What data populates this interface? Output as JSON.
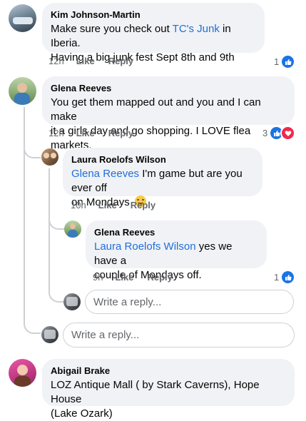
{
  "comments": [
    {
      "author": "Kim Johnson-Martin",
      "text_line1_pre": "Make sure you check out ",
      "text_line1_link": "TC's Junk",
      "text_line1_post": " in Iberia.",
      "text_line2": "Having a big junk fest Sept 8th and 9th",
      "time": "12h",
      "like": "Like",
      "reply": "Reply",
      "reaction_count": "1",
      "reactions": [
        "like-icon"
      ]
    },
    {
      "author": "Glena Reeves",
      "text_line1": "You get them mapped out and you and I can make",
      "text_line2": "it a girls day and go shopping. I LOVE flea markets.",
      "time": "12h",
      "like": "Like",
      "reply": "Reply",
      "reaction_count": "3",
      "reactions": [
        "like-icon",
        "love-icon"
      ]
    },
    {
      "author": "Laura Roelofs Wilson",
      "mention": "Glena Reeves",
      "text_line1_post": " I'm game but are you ever off",
      "text_line2": "on Mondays",
      "emoji": "☺",
      "time": "10h",
      "like": "Like",
      "reply": "Reply"
    },
    {
      "author": "Glena Reeves",
      "mention": "Laura Roelofs Wilson",
      "text_line1_post": " yes we have a",
      "text_line2": "couple of Mondays off.",
      "time": "9h",
      "like": "Like",
      "reply": "Reply",
      "reaction_count": "1",
      "reactions": [
        "like-icon"
      ]
    },
    {
      "author": "Abigail Brake",
      "text_line1": "LOZ Antique Mall ( by Stark Caverns), Hope House",
      "text_line2": "(Lake Ozark)"
    }
  ],
  "reply_inputs": {
    "nested_placeholder": "Write a reply...",
    "thread_placeholder": "Write a reply..."
  },
  "colors": {
    "link": "#216fdb",
    "bubble": "#f0f2f5",
    "like": "#1b74e4",
    "love": "#f0284a"
  }
}
